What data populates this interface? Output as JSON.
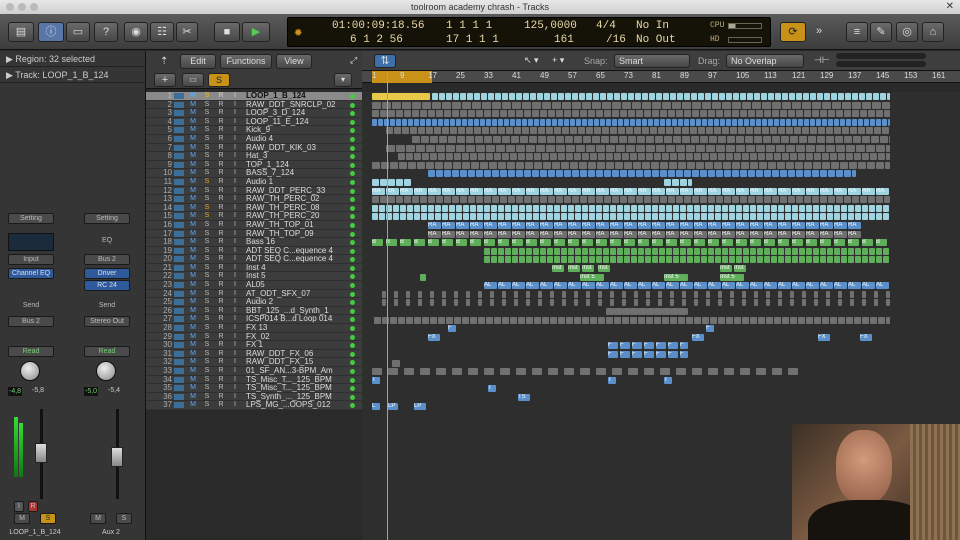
{
  "window": {
    "title": "toolroom academy chrash - Tracks"
  },
  "toolbar": {
    "cycle_icon": "cycle-icon"
  },
  "lcd": {
    "position_time": "01:00:09:18.56",
    "position_bars": "1  1  1     1",
    "tempo": "125,0000",
    "signature": "4/4",
    "midi_in": "No In",
    "locator_start": "6  1  2    56",
    "locator_end": "17  1  1     1",
    "tempo_bottom": "161",
    "division": "/16",
    "midi_out": "No Out",
    "cpu_label": "CPU",
    "hd_label": "HD"
  },
  "inspector": {
    "region_label": "Region: 32 selected",
    "track_label": "Track:  LOOP_1_B_124",
    "strip1": {
      "setting": "Setting",
      "input": "Input",
      "eq": "Channel EQ",
      "send": "Send",
      "output": "Bus 2",
      "auto": "Read",
      "pan_l": "-4,8",
      "pan_r": "-5,8",
      "name": "LOOP_1_B_124",
      "m": "M",
      "s": "S",
      "i": "I",
      "r": "R"
    },
    "strip2": {
      "setting": "Setting",
      "eq": "EQ",
      "input": "Bus 2",
      "driver": "Driver",
      "rc": "RC 24",
      "send": "Send",
      "output": "Stereo Out",
      "auto": "Read",
      "pan_l": "-5,0",
      "pan_r": "-5,4",
      "name": "Aux 2",
      "m": "M",
      "s": "S"
    }
  },
  "trackheader": {
    "edit": "Edit",
    "functions": "Functions",
    "view": "View",
    "s_label": "S"
  },
  "arrange": {
    "snap_label": "Snap:",
    "snap_value": "Smart",
    "drag_label": "Drag:",
    "drag_value": "No Overlap"
  },
  "ruler": {
    "ticks": [
      "1",
      "9",
      "17",
      "25",
      "33",
      "41",
      "49",
      "57",
      "65",
      "73",
      "81",
      "89",
      "97",
      "105",
      "113",
      "121",
      "129",
      "137",
      "145",
      "153",
      "161"
    ]
  },
  "tracks": [
    {
      "n": "1",
      "name": "LOOP_1_B_124",
      "sel": true
    },
    {
      "n": "2",
      "name": "RAW_DDT_SNRCLP_02"
    },
    {
      "n": "3",
      "name": "LOOP_3_D_124"
    },
    {
      "n": "4",
      "name": "LOOP_11_E_124"
    },
    {
      "n": "5",
      "name": "Kick_9"
    },
    {
      "n": "6",
      "name": "Audio 4"
    },
    {
      "n": "7",
      "name": "RAW_DDT_KIK_03"
    },
    {
      "n": "8",
      "name": "Hat_3"
    },
    {
      "n": "9",
      "name": "TOP_1_124"
    },
    {
      "n": "10",
      "name": "BASS_7_124"
    },
    {
      "n": "11",
      "name": "Audio 1"
    },
    {
      "n": "12",
      "name": "RAW_DDT_PERC_33"
    },
    {
      "n": "13",
      "name": "RAW_TH_PERC_02"
    },
    {
      "n": "14",
      "name": "RAW_TH_PERC_08"
    },
    {
      "n": "15",
      "name": "RAW_TH_PERC_20"
    },
    {
      "n": "16",
      "name": "RAW_TH_TOP_01"
    },
    {
      "n": "17",
      "name": "RAW_TH_TOP_09"
    },
    {
      "n": "18",
      "name": "Bass 16"
    },
    {
      "n": "19",
      "name": "ADT SEQ C...equence 4"
    },
    {
      "n": "20",
      "name": "ADT SEQ C...equence 4"
    },
    {
      "n": "21",
      "name": "Inst 4"
    },
    {
      "n": "22",
      "name": "Inst 5"
    },
    {
      "n": "23",
      "name": "AL05"
    },
    {
      "n": "24",
      "name": "AT_ODT_SFX_07"
    },
    {
      "n": "25",
      "name": "Audio 2"
    },
    {
      "n": "26",
      "name": "BBT_125_...d_Synth_1"
    },
    {
      "n": "27",
      "name": "ICSP014 B...d Loop 014"
    },
    {
      "n": "28",
      "name": "FX 13"
    },
    {
      "n": "29",
      "name": "FX_02"
    },
    {
      "n": "30",
      "name": "FX 1"
    },
    {
      "n": "31",
      "name": "RAW_DDT_FX_06"
    },
    {
      "n": "32",
      "name": "RAW_DDT_FX_15"
    },
    {
      "n": "33",
      "name": "01_SF_AN...3-BPM_Am"
    },
    {
      "n": "34",
      "name": "TS_Misc_T..._125_BPM"
    },
    {
      "n": "35",
      "name": "TS_Misc_T..._125_BPM"
    },
    {
      "n": "36",
      "name": "TS_Synth_..._125_BPM"
    },
    {
      "n": "37",
      "name": "LPS_MG_...OOPS_012"
    }
  ],
  "colors": {
    "accent": "#c89218",
    "selected_region": "#e8c848",
    "audio_region": "#9fd3e0",
    "mid_region": "#5a8fc9",
    "green_region": "#5fae5a",
    "gray_region": "#707070"
  }
}
